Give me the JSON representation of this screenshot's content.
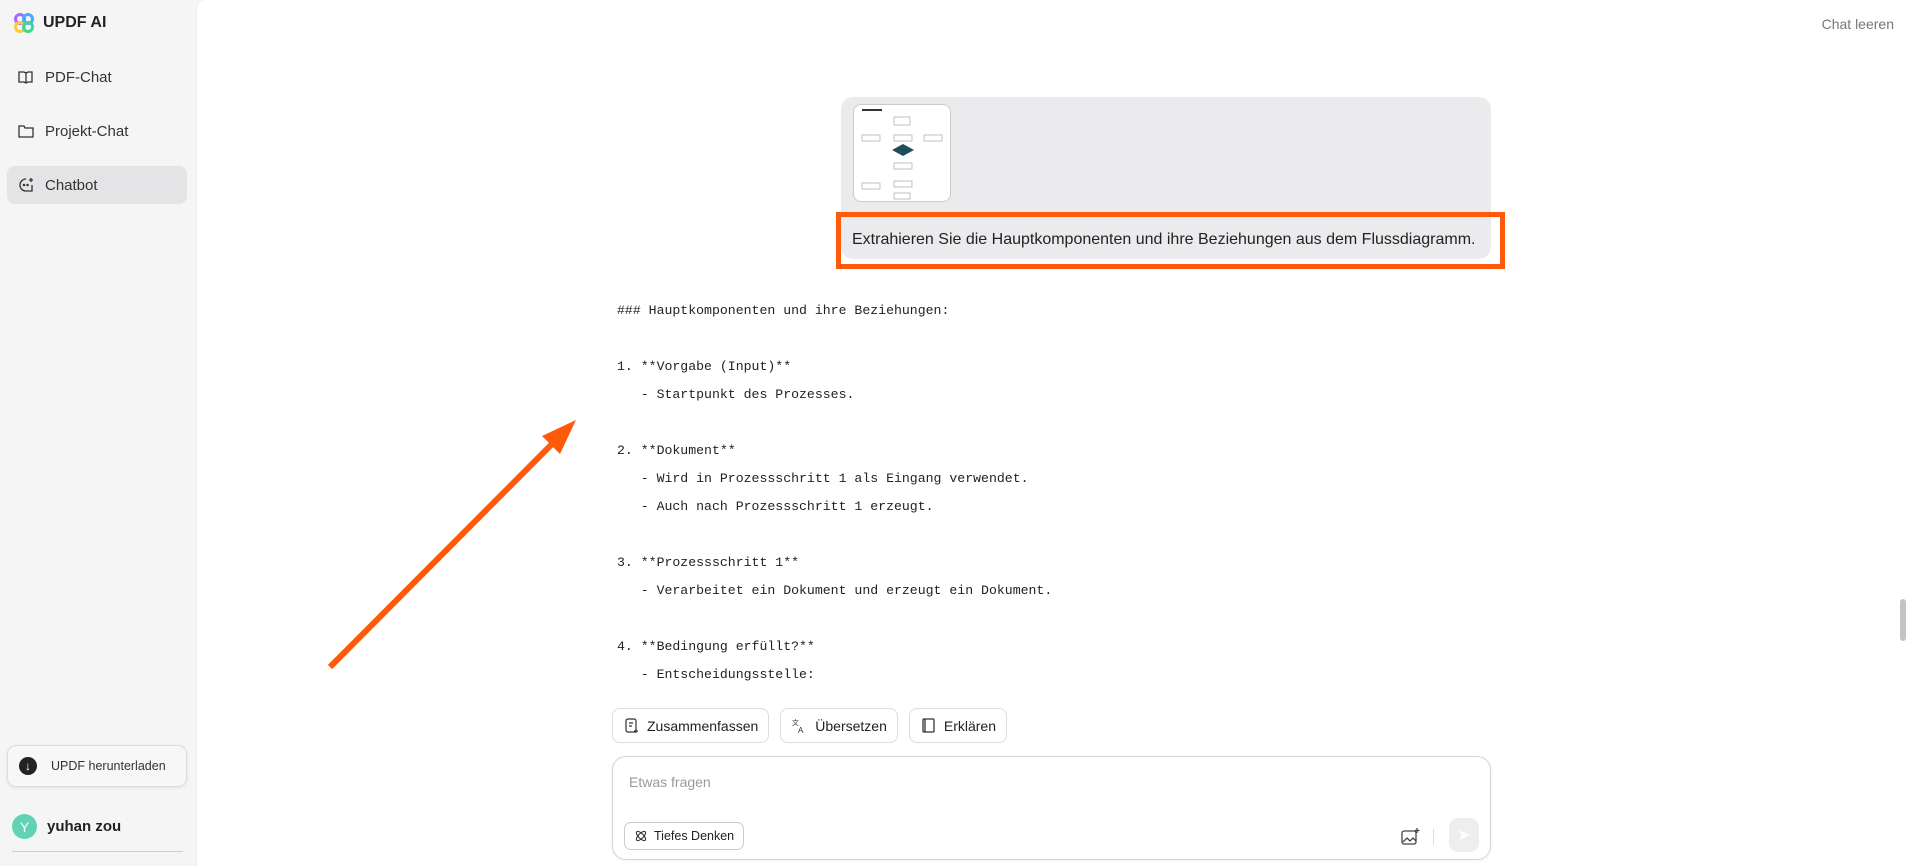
{
  "app": {
    "title": "UPDF AI"
  },
  "sidebar": {
    "items": [
      {
        "label": "PDF-Chat"
      },
      {
        "label": "Projekt-Chat"
      },
      {
        "label": "Chatbot",
        "active": true
      }
    ],
    "download_label": "UPDF herunterladen",
    "user": {
      "initial": "Y",
      "name": "yuhan zou"
    }
  },
  "header": {
    "clear_label": "Chat leeren"
  },
  "conversation": {
    "user_message": "Extrahieren Sie die Hauptkomponenten und ihre Beziehungen aus dem Flussdiagramm.",
    "response_lines": [
      "### Hauptkomponenten und ihre Beziehungen:",
      "",
      "1. **Vorgabe (Input)**",
      "   - Startpunkt des Prozesses.",
      "",
      "2. **Dokument**",
      "   - Wird in Prozessschritt 1 als Eingang verwendet.",
      "   - Auch nach Prozessschritt 1 erzeugt.",
      "",
      "3. **Prozessschritt 1**",
      "   - Verarbeitet ein Dokument und erzeugt ein Dokument.",
      "",
      "4. **Bedingung erfüllt?**",
      "   - Entscheidungsstelle:"
    ]
  },
  "actions": [
    {
      "label": "Zusammenfassen"
    },
    {
      "label": "Übersetzen"
    },
    {
      "label": "Erklären"
    }
  ],
  "composer": {
    "placeholder": "Etwas fragen",
    "deep_thinking_label": "Tiefes Denken"
  },
  "colors": {
    "highlight": "#ff5a0a",
    "accent_avatar": "#5fd3b3"
  }
}
